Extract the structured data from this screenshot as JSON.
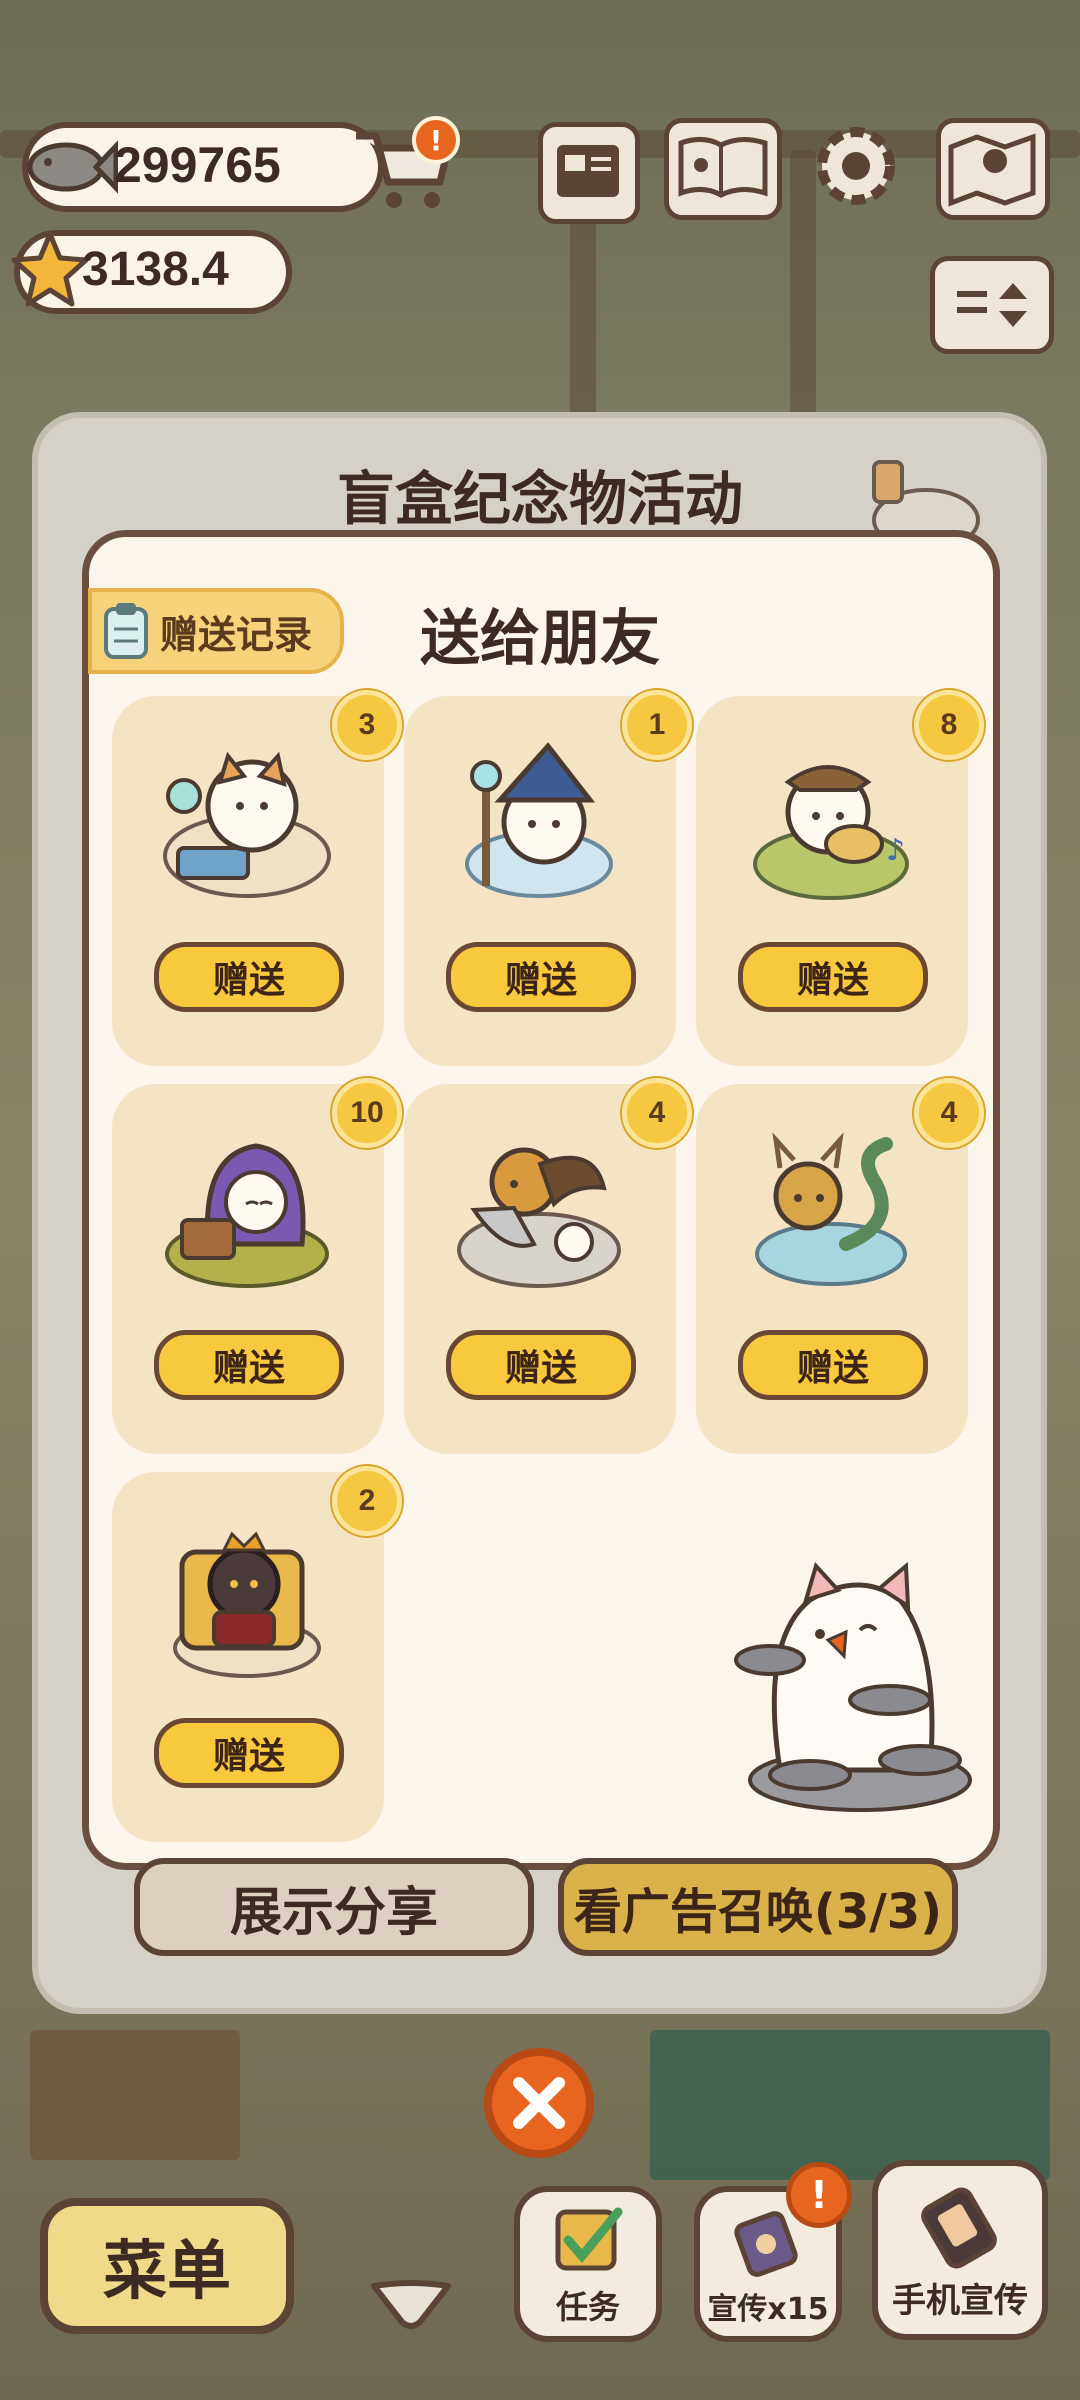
{
  "hud": {
    "fish_coins": "299765",
    "stars": "3138.4"
  },
  "dialog": {
    "title": "盲盒纪念物活动",
    "panel_title": "送给朋友",
    "record_label": "赠送记录",
    "items": [
      {
        "count": "3",
        "button": "赠送",
        "icon": "alchemist-cat-figure"
      },
      {
        "count": "1",
        "button": "赠送",
        "icon": "wizard-cat-figure"
      },
      {
        "count": "8",
        "button": "赠送",
        "icon": "bard-cat-figure"
      },
      {
        "count": "10",
        "button": "赠送",
        "icon": "hooded-cat-treasure-figure"
      },
      {
        "count": "4",
        "button": "赠送",
        "icon": "warrior-cat-figure"
      },
      {
        "count": "4",
        "button": "赠送",
        "icon": "dragon-cat-figure"
      },
      {
        "count": "2",
        "button": "赠送",
        "icon": "king-cat-figure"
      }
    ],
    "share_button": "展示分享",
    "ad_button": "看广告召唤(3/3)"
  },
  "bottom_bar": {
    "menu": "菜单",
    "tasks": "任务",
    "promote": "宣传x15",
    "phone_promote": "手机宣传"
  },
  "colors": {
    "button_yellow": "#f8c93c",
    "outline_brown": "#5b4336",
    "close_orange": "#e8651f",
    "badge_gold": "#f6c740"
  }
}
